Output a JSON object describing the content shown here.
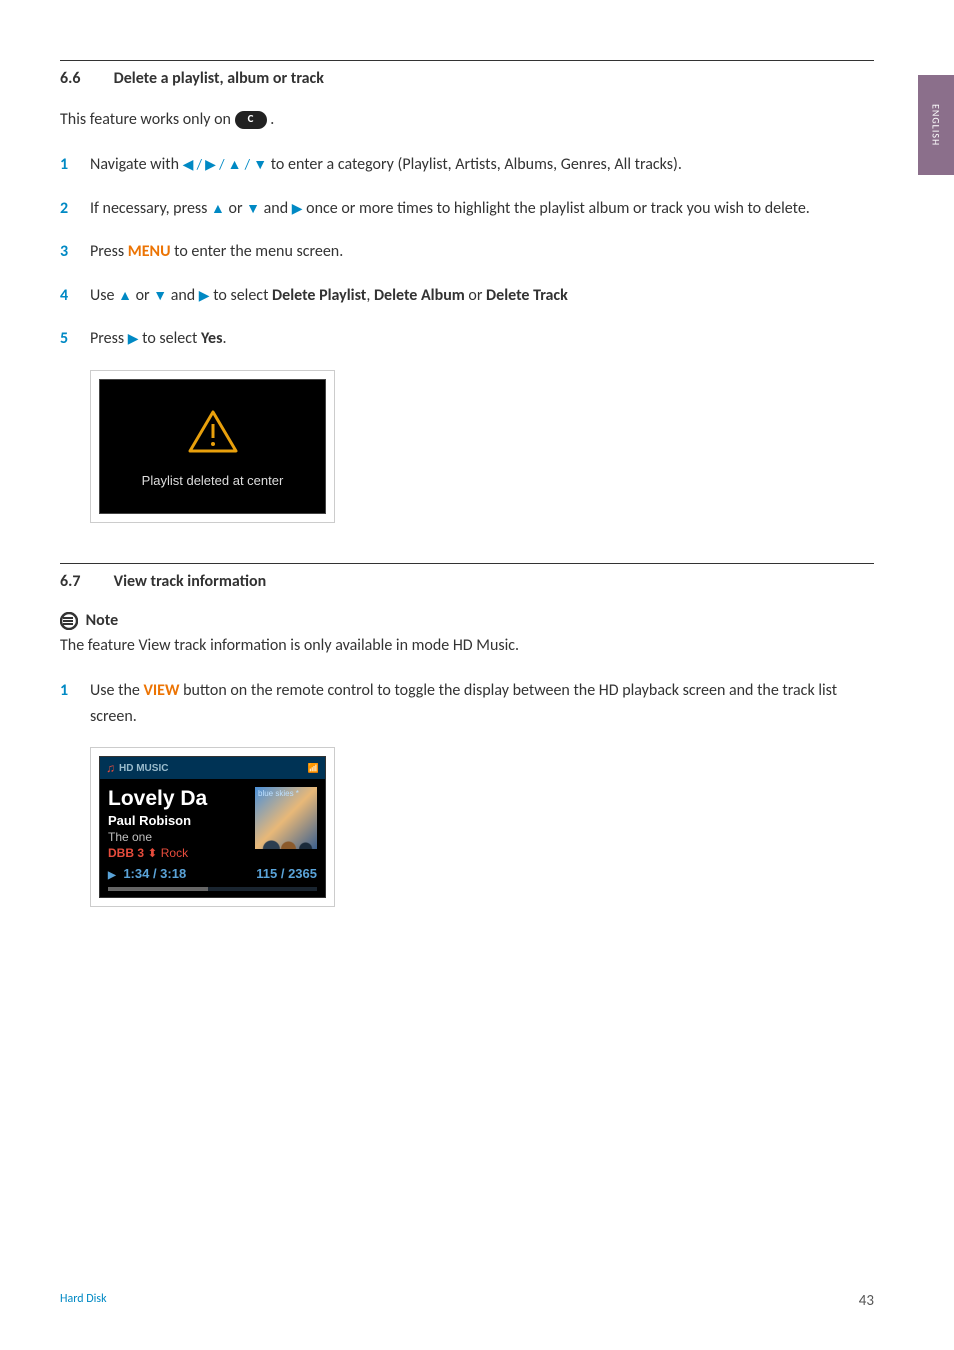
{
  "side_tab": "ENGLISH",
  "section_6_6": {
    "num": "6.6",
    "title": "Delete a playlist, album or track",
    "intro_pre": "This feature works only on ",
    "intro_post": ".",
    "steps": [
      {
        "num": "1",
        "pre": "Navigate with ",
        "arrows": "◀ / ▶ / ▲ / ▼",
        "post": " to enter a category (Playlist,  Artists,  Albums, Genres,  All tracks)."
      },
      {
        "num": "2",
        "pre": "If necessary, press ",
        "arr1": "▲",
        "mid1": " or ",
        "arr2": "▼",
        "mid2": " and ",
        "arr3": "▶",
        "post": " once or more times to highlight the playlist album or track you wish to delete."
      },
      {
        "num": "3",
        "pre": "Press ",
        "key": "MENU",
        "post": " to enter the menu screen."
      },
      {
        "num": "4",
        "pre": "Use ",
        "arr1": "▲",
        "mid1": " or ",
        "arr2": "▼",
        "mid2": " and ",
        "arr3": "▶",
        "mid3": " to select ",
        "b1": "Delete Playlist",
        "sep1": ", ",
        "b2": "Delete Album",
        "sep2": " or ",
        "b3": "Delete Track"
      },
      {
        "num": "5",
        "pre": "Press ",
        "arr1": "▶",
        "mid1": " to select ",
        "b1": "Yes",
        "post": "."
      }
    ],
    "screenshot_text": "Playlist deleted at center"
  },
  "section_6_7": {
    "num": "6.7",
    "title": "View track information",
    "note_label": "Note",
    "note_text": "The feature View track information is only available in mode HD Music.",
    "steps": [
      {
        "num": "1",
        "pre": "Use the ",
        "key": "VIEW",
        "post": " button on the remote control to toggle the display between the HD playback screen and the track list screen."
      }
    ],
    "hd_screen": {
      "header": "HD MUSIC",
      "title": "Lovely Da",
      "artist": "Paul Robison",
      "album": "The one",
      "dbb": "DBB 3",
      "genre": "Rock",
      "cover": "blue skies *",
      "time": "1:34 / 3:18",
      "counter": "115 / 2365"
    }
  },
  "footer": {
    "section": "Hard Disk",
    "page": "43"
  }
}
